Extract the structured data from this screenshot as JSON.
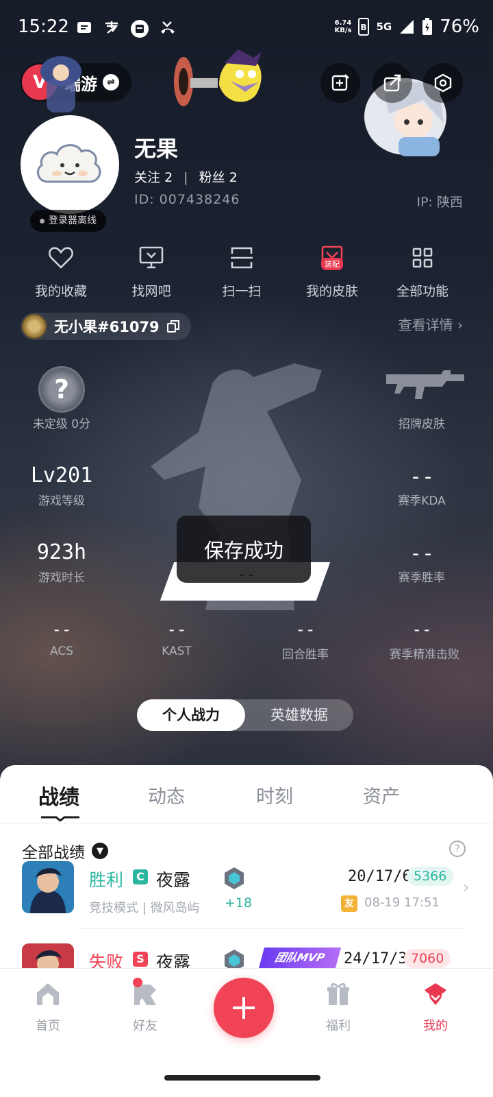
{
  "status_bar": {
    "time": "15:22",
    "net_speed_value": "6.74",
    "net_speed_unit": "KB/s",
    "network": "5G",
    "battery": "76%"
  },
  "header": {
    "game_label": "端游",
    "game_logo_letter": "V"
  },
  "profile": {
    "name": "无果",
    "following_label": "关注",
    "following_count": "2",
    "followers_label": "粉丝",
    "followers_count": "2",
    "id_text": "ID: 007438246",
    "ip_text": "IP: 陕西",
    "login_status": "登录器离线"
  },
  "functions": [
    {
      "label": "我的收藏",
      "icon": "heart-icon"
    },
    {
      "label": "找网吧",
      "icon": "monitor-icon"
    },
    {
      "label": "扫一扫",
      "icon": "scan-icon"
    },
    {
      "label": "我的皮肤",
      "icon": "skin-icon",
      "tag": "装配"
    },
    {
      "label": "全部功能",
      "icon": "grid-icon"
    }
  ],
  "riot": {
    "riot_id": "无小果#61079",
    "detail_link": "查看详情"
  },
  "stats": {
    "rank_label": "未定级 0分",
    "rank_symbol": "?",
    "skin_label": "招牌皮肤",
    "level_value": "Lv201",
    "level_label": "游戏等级",
    "kda_value": "--",
    "kda_label": "赛季KDA",
    "hours_value": "923h",
    "hours_label": "游戏时长",
    "winrate_value": "--",
    "winrate_label": "赛季胜率",
    "center_value": "--",
    "acs_value": "--",
    "acs_label": "ACS",
    "kast_value": "--",
    "kast_label": "KAST",
    "round_value": "--",
    "round_label": "回合胜率",
    "hs_value": "--",
    "hs_label": "赛季精准击败"
  },
  "toast": "保存成功",
  "segment": {
    "active": "个人战力",
    "inactive": "英雄数据"
  },
  "content_tabs": [
    "战绩",
    "动态",
    "时刻",
    "资产"
  ],
  "filter": {
    "label": "全部战绩",
    "help": "?"
  },
  "matches": [
    {
      "result": "胜利",
      "result_color": "#2bb6a0",
      "mode_letter": "C",
      "mode_color": "#2bb6a0",
      "agent": "夜露",
      "mode_map": "竞技模式 | 微风岛屿",
      "rr_change": "+18",
      "kda": "20/17/6",
      "score": "5366",
      "score_color": "#2bb6a0",
      "score_bg": "#e3f6f2",
      "friend_tag": "友",
      "time": "08-19 17:51"
    },
    {
      "result": "失败",
      "result_color": "#f04456",
      "mode_letter": "S",
      "mode_color": "#f04456",
      "agent": "夜露",
      "mvp": "团队MVP",
      "kda": "24/17/3",
      "score": "7060",
      "score_color": "#f04456",
      "score_bg": "#fde6e8"
    }
  ],
  "bottom_nav": [
    {
      "label": "首页",
      "icon": "home-icon"
    },
    {
      "label": "好友",
      "icon": "friends-icon"
    },
    {
      "label": "福利",
      "icon": "gift-icon"
    },
    {
      "label": "我的",
      "icon": "profile-icon"
    }
  ],
  "colors": {
    "accent": "#f04456",
    "win": "#2bb6a0",
    "loss": "#f04456"
  }
}
